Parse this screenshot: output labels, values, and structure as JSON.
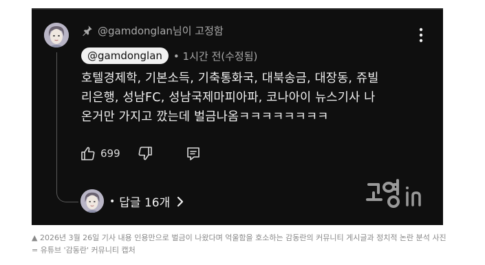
{
  "comment": {
    "pinned_label": "@gamdonglan님이 고정함",
    "author": "@gamdonglan",
    "meta": "• 1시간 전(수정됨)",
    "text": "호텔경제학, 기본소득, 기축통화국, 대북송금, 대장동, 쥬빌\n리은행, 성남FC, 성남국제마피아파, 코나아이 뉴스기사 나\n온거만 가지고 깠는데 벌금나옴ㅋㅋㅋㅋㅋㅋㅋㅋ",
    "like_count": "699",
    "replies": "답글 16개",
    "replies_dot": "•"
  },
  "icons": {
    "pin": "pin-icon",
    "more": "more-vertical-icon",
    "like": "thumbs-up-icon",
    "dislike": "thumbs-down-icon",
    "reply": "comment-reply-icon",
    "chevron": "chevron-right-icon",
    "watermark": "goyang-in-logo"
  },
  "colors": {
    "background": "#0f0f0f",
    "text": "#f1f1f1",
    "secondary_text": "#aaaaaa",
    "chip": "#f1f1f1"
  },
  "caption": "▲ 2026년 3월 26일 기사 내용 인용만으로 벌금이 나왔다며 억울함을 호소하는 감동란의 커뮤니티 게시글과 정치적 논란 분석 사진= 유튜브 '감동란' 커뮤니티 캡처"
}
